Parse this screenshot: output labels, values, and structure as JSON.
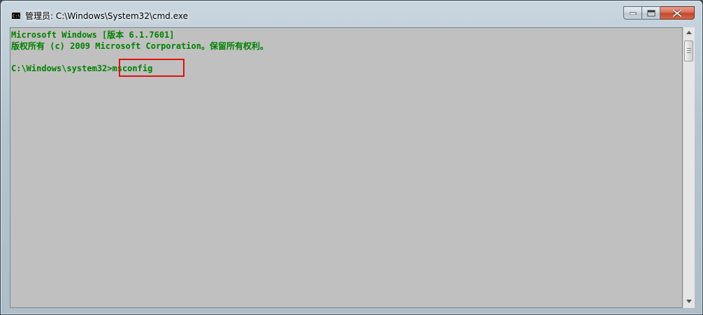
{
  "window": {
    "title": "管理员: C:\\Windows\\System32\\cmd.exe"
  },
  "icons": {
    "app": "cmd-icon",
    "minimize": "minimize-icon",
    "maximize": "maximize-icon",
    "close": "close-icon",
    "scroll_up": "scroll-up-arrow-icon",
    "scroll_down": "scroll-down-arrow-icon"
  },
  "colors": {
    "console_background": "#c0c0c0",
    "console_text": "#008000",
    "highlight_border": "#e01010"
  },
  "console": {
    "line1": "Microsoft Windows [版本 6.1.7601]",
    "line2": "版权所有 (c) 2009 Microsoft Corporation。保留所有权利。",
    "prompt": "C:\\Windows\\system32>",
    "command": "msconfig"
  }
}
